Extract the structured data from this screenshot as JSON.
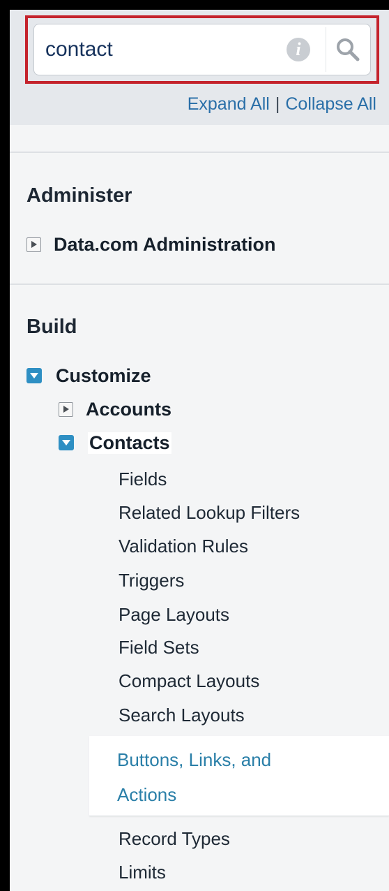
{
  "search": {
    "value": "contact",
    "info_icon": "info-icon",
    "button_icon": "magnifier-icon"
  },
  "links": {
    "expand_all": "Expand All",
    "separator": "|",
    "collapse_all": "Collapse All"
  },
  "sections": {
    "administer": {
      "title": "Administer",
      "items": [
        {
          "label": "Data.com Administration",
          "state": "collapsed"
        }
      ]
    },
    "build": {
      "title": "Build",
      "customize": {
        "label": "Customize",
        "state": "expanded"
      },
      "accounts": {
        "label": "Accounts",
        "state": "collapsed"
      },
      "contacts": {
        "label": "Contacts",
        "state": "expanded",
        "items": [
          "Fields",
          "Related Lookup Filters",
          "Validation Rules",
          "Triggers",
          "Page Layouts",
          "Field Sets",
          "Compact Layouts",
          "Search Layouts",
          "Buttons, Links, and Actions",
          "Record Types",
          "Limits"
        ],
        "selected_item_lines": [
          "Buttons, Links, and",
          "Actions"
        ]
      }
    }
  },
  "colors": {
    "highlight_border": "#c4232c",
    "link": "#2a6fa8",
    "tree_toggle": "#2e8fc3",
    "selected_text": "#2a7fa8"
  }
}
